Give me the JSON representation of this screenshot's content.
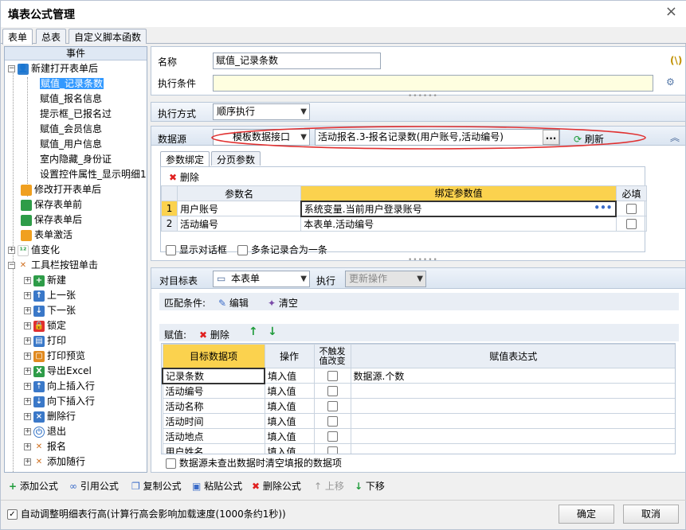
{
  "window": {
    "title": "填表公式管理"
  },
  "tabs": [
    "表单",
    "总表",
    "自定义脚本函数"
  ],
  "tree": {
    "header": "事件",
    "nodes": [
      {
        "label": "新建打开表单后",
        "icon": "user-icon"
      },
      {
        "label": "赋值_记录条数",
        "selected": true
      },
      {
        "label": "赋值_报名信息"
      },
      {
        "label": "提示框_已报名过"
      },
      {
        "label": "赋值_会员信息"
      },
      {
        "label": "赋值_用户信息"
      },
      {
        "label": "室内隐藏_身份证"
      },
      {
        "label": "设置控件属性_显示明细1"
      },
      {
        "label": "修改打开表单后",
        "icon": "folder-open-icon"
      },
      {
        "label": "保存表单前",
        "icon": "folder-save-icon"
      },
      {
        "label": "保存表单后",
        "icon": "folder-save-icon"
      },
      {
        "label": "表单激活",
        "icon": "folder-icon"
      },
      {
        "label": "值变化",
        "icon": "value-change-icon"
      },
      {
        "label": "工具栏按钮单击",
        "icon": "tools-icon"
      },
      {
        "label": "新建",
        "icon": "new-icon"
      },
      {
        "label": "上一张",
        "icon": "prev-icon"
      },
      {
        "label": "下一张",
        "icon": "next-icon"
      },
      {
        "label": "锁定",
        "icon": "lock-icon"
      },
      {
        "label": "打印",
        "icon": "print-icon"
      },
      {
        "label": "打印预览",
        "icon": "print-preview-icon"
      },
      {
        "label": "导出Excel",
        "icon": "excel-icon"
      },
      {
        "label": "向上插入行",
        "icon": "insert-up-icon"
      },
      {
        "label": "向下插入行",
        "icon": "insert-down-icon"
      },
      {
        "label": "删除行",
        "icon": "delete-row-icon"
      },
      {
        "label": "退出",
        "icon": "power-icon"
      },
      {
        "label": "报名",
        "icon": "tools-icon"
      },
      {
        "label": "添加随行",
        "icon": "tools-icon"
      }
    ]
  },
  "form": {
    "name_label": "名称",
    "name_value": "赋值_记录条数",
    "condition_label": "执行条件",
    "condition_value": "",
    "exec_mode_label": "执行方式",
    "exec_mode_value": "顺序执行",
    "datasource_label": "数据源",
    "datasource_type": "模板数据接口",
    "datasource_value": "活动报名.3-报名记录数(用户账号,活动编号)",
    "browse_label": "...",
    "refresh_label": "刷新",
    "param_tabs": [
      "参数绑定",
      "分页参数"
    ],
    "delete_label": "删除",
    "param_grid": {
      "headers": [
        "参数名",
        "绑定参数值",
        "必填"
      ],
      "rows": [
        {
          "num": "1",
          "name": "用户账号",
          "value": "系统变量.当前用户登录账号"
        },
        {
          "num": "2",
          "name": "活动编号",
          "value": "本表单.活动编号"
        }
      ]
    },
    "show_dialog_label": "显示对话框",
    "merge_records_label": "多条记录合为一条",
    "target_label": "对目标表",
    "target_value": "本表单",
    "exec_label": "执行",
    "exec_value": "更新操作",
    "match_label": "匹配条件:",
    "edit_label": "编辑",
    "clear_label": "清空",
    "assign_label": "赋值:",
    "assign_grid": {
      "headers": [
        "目标数据项",
        "操作",
        "不触发值改变",
        "赋值表达式"
      ],
      "rows": [
        {
          "target": "记录条数",
          "op": "填入值",
          "expr": "数据源.个数"
        },
        {
          "target": "活动编号",
          "op": "填入值",
          "expr": ""
        },
        {
          "target": "活动名称",
          "op": "填入值",
          "expr": ""
        },
        {
          "target": "活动时间",
          "op": "填入值",
          "expr": ""
        },
        {
          "target": "活动地点",
          "op": "填入值",
          "expr": ""
        },
        {
          "target": "用户姓名",
          "op": "填入值",
          "expr": ""
        }
      ]
    },
    "clear_on_empty_label": "数据源未查出数据时清空填报的数据项"
  },
  "toolbar": {
    "add": "添加公式",
    "ref": "引用公式",
    "copy": "复制公式",
    "paste": "粘贴公式",
    "delete": "删除公式",
    "up": "上移",
    "down": "下移"
  },
  "footer": {
    "auto_adjust_label": "自动调整明细表行高(计算行高会影响加载速度(1000条约1秒))",
    "ok": "确定",
    "cancel": "取消"
  },
  "colors": {
    "accent": "#3399ff",
    "highlight_header": "#fbd24e",
    "callout": "#e03030"
  }
}
